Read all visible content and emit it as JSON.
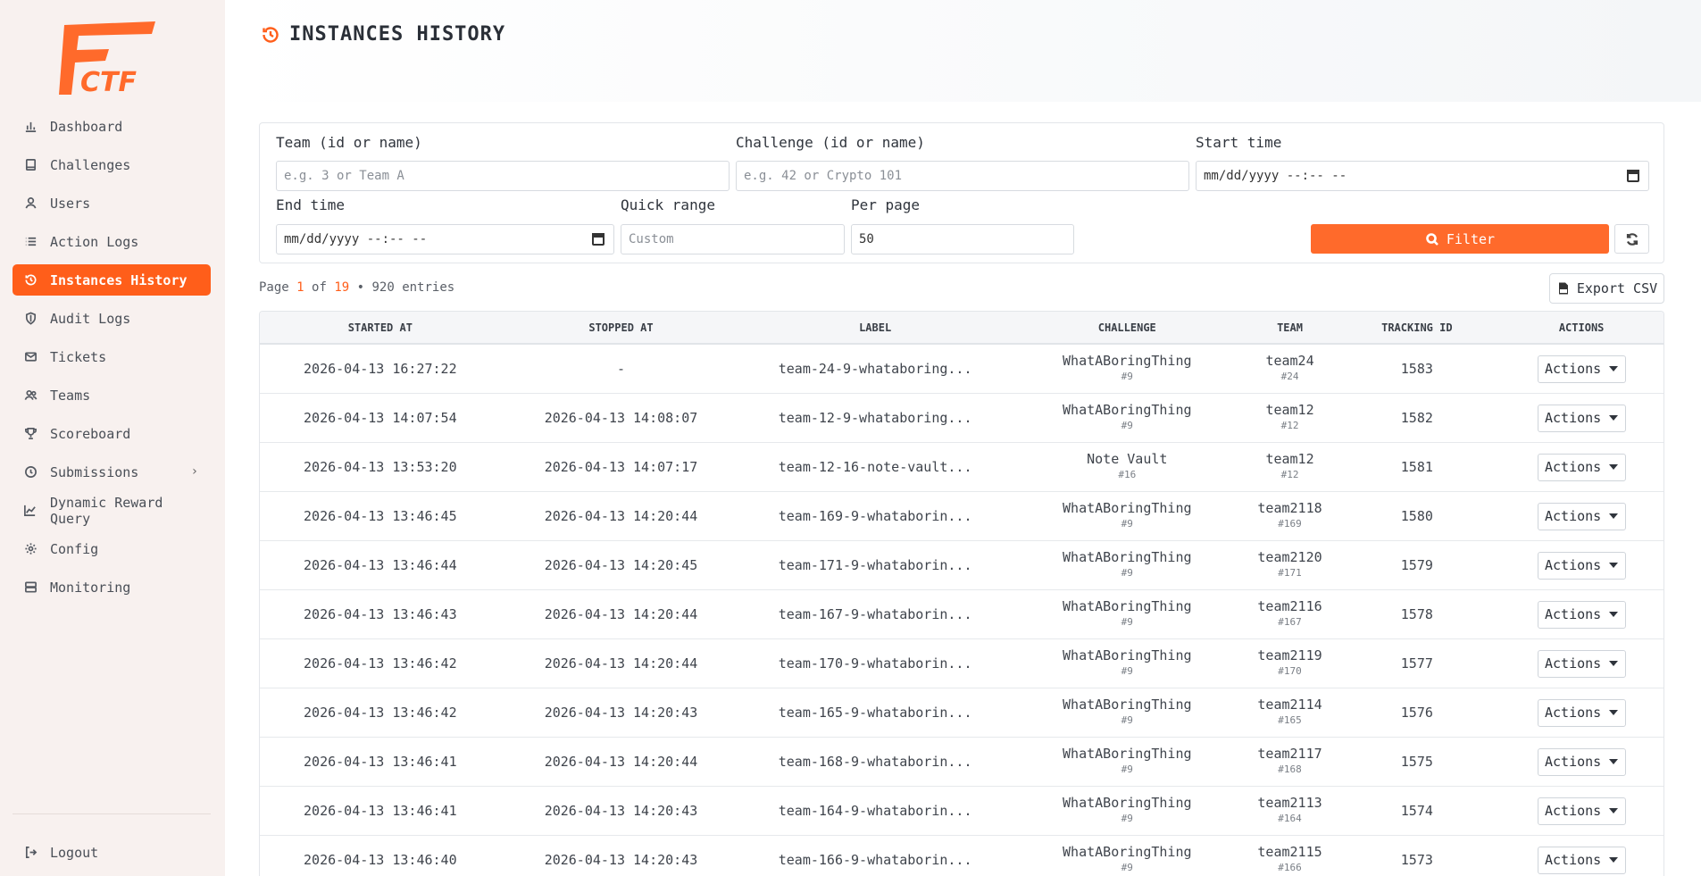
{
  "brand": {
    "logo_text": "CTF",
    "accent": "#ff5e1a"
  },
  "sidebar": {
    "items": [
      {
        "label": "Dashboard",
        "icon": "bar-chart-icon"
      },
      {
        "label": "Challenges",
        "icon": "book-icon"
      },
      {
        "label": "Users",
        "icon": "user-icon"
      },
      {
        "label": "Action Logs",
        "icon": "list-icon"
      },
      {
        "label": "Instances History",
        "icon": "history-icon",
        "active": true
      },
      {
        "label": "Audit Logs",
        "icon": "shield-icon"
      },
      {
        "label": "Tickets",
        "icon": "mail-icon"
      },
      {
        "label": "Teams",
        "icon": "users-icon"
      },
      {
        "label": "Scoreboard",
        "icon": "trophy-icon"
      },
      {
        "label": "Submissions",
        "icon": "check-circle-icon"
      },
      {
        "label": "Dynamic Reward Query",
        "icon": "line-chart-icon"
      },
      {
        "label": "Config",
        "icon": "gear-icon"
      },
      {
        "label": "Monitoring",
        "icon": "server-icon"
      }
    ],
    "logout": "Logout"
  },
  "header": {
    "title": "INSTANCES HISTORY"
  },
  "filters": {
    "team_label": "Team (id or name)",
    "team_placeholder": "e.g. 3 or Team A",
    "challenge_label": "Challenge (id or name)",
    "challenge_placeholder": "e.g. 42 or Crypto 101",
    "start_label": "Start time",
    "start_value": "mm/dd/yyyy --:-- --",
    "end_label": "End time",
    "end_value": "mm/dd/yyyy --:-- --",
    "quick_label": "Quick range",
    "quick_placeholder": "Custom",
    "per_page_label": "Per page",
    "per_page_value": "50",
    "filter_button": "Filter"
  },
  "pagination": {
    "prefix": "Page",
    "current": "1",
    "of": "of",
    "total": "19",
    "entries": "• 920 entries"
  },
  "export_button": "Export CSV",
  "table": {
    "headers": [
      "STARTED AT",
      "STOPPED AT",
      "LABEL",
      "CHALLENGE",
      "TEAM",
      "TRACKING ID",
      "ACTIONS"
    ],
    "action_label": "Actions",
    "rows": [
      {
        "started": "2026-04-13 16:27:22",
        "stopped": "-",
        "label": "team-24-9-whataboring...",
        "challenge": "WhatABoringThing",
        "challenge_id": "#9",
        "team": "team24",
        "team_id": "#24",
        "tracking": "1583"
      },
      {
        "started": "2026-04-13 14:07:54",
        "stopped": "2026-04-13 14:08:07",
        "label": "team-12-9-whataboring...",
        "challenge": "WhatABoringThing",
        "challenge_id": "#9",
        "team": "team12",
        "team_id": "#12",
        "tracking": "1582"
      },
      {
        "started": "2026-04-13 13:53:20",
        "stopped": "2026-04-13 14:07:17",
        "label": "team-12-16-note-vault...",
        "challenge": "Note Vault",
        "challenge_id": "#16",
        "team": "team12",
        "team_id": "#12",
        "tracking": "1581"
      },
      {
        "started": "2026-04-13 13:46:45",
        "stopped": "2026-04-13 14:20:44",
        "label": "team-169-9-whataborin...",
        "challenge": "WhatABoringThing",
        "challenge_id": "#9",
        "team": "team2118",
        "team_id": "#169",
        "tracking": "1580"
      },
      {
        "started": "2026-04-13 13:46:44",
        "stopped": "2026-04-13 14:20:45",
        "label": "team-171-9-whataborin...",
        "challenge": "WhatABoringThing",
        "challenge_id": "#9",
        "team": "team2120",
        "team_id": "#171",
        "tracking": "1579"
      },
      {
        "started": "2026-04-13 13:46:43",
        "stopped": "2026-04-13 14:20:44",
        "label": "team-167-9-whataborin...",
        "challenge": "WhatABoringThing",
        "challenge_id": "#9",
        "team": "team2116",
        "team_id": "#167",
        "tracking": "1578"
      },
      {
        "started": "2026-04-13 13:46:42",
        "stopped": "2026-04-13 14:20:44",
        "label": "team-170-9-whataborin...",
        "challenge": "WhatABoringThing",
        "challenge_id": "#9",
        "team": "team2119",
        "team_id": "#170",
        "tracking": "1577"
      },
      {
        "started": "2026-04-13 13:46:42",
        "stopped": "2026-04-13 14:20:43",
        "label": "team-165-9-whataborin...",
        "challenge": "WhatABoringThing",
        "challenge_id": "#9",
        "team": "team2114",
        "team_id": "#165",
        "tracking": "1576"
      },
      {
        "started": "2026-04-13 13:46:41",
        "stopped": "2026-04-13 14:20:44",
        "label": "team-168-9-whataborin...",
        "challenge": "WhatABoringThing",
        "challenge_id": "#9",
        "team": "team2117",
        "team_id": "#168",
        "tracking": "1575"
      },
      {
        "started": "2026-04-13 13:46:41",
        "stopped": "2026-04-13 14:20:43",
        "label": "team-164-9-whataborin...",
        "challenge": "WhatABoringThing",
        "challenge_id": "#9",
        "team": "team2113",
        "team_id": "#164",
        "tracking": "1574"
      },
      {
        "started": "2026-04-13 13:46:40",
        "stopped": "2026-04-13 14:20:43",
        "label": "team-166-9-whataborin...",
        "challenge": "WhatABoringThing",
        "challenge_id": "#9",
        "team": "team2115",
        "team_id": "#166",
        "tracking": "1573"
      }
    ]
  }
}
